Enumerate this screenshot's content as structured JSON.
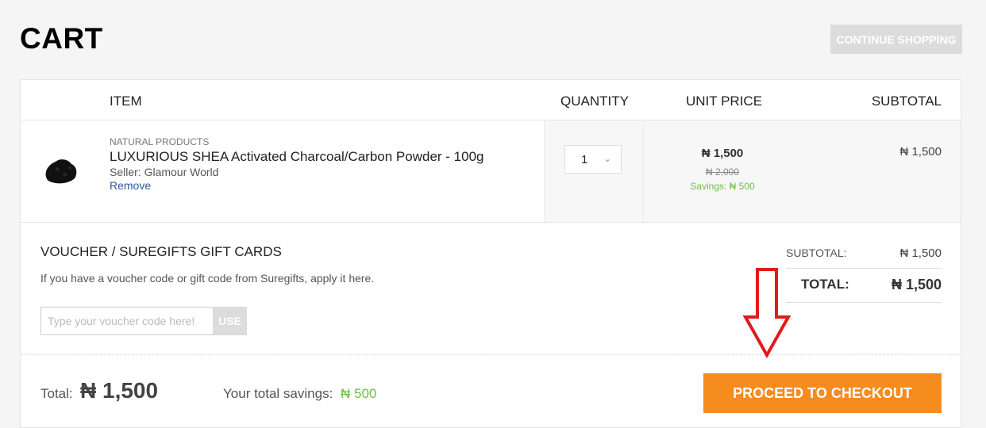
{
  "page": {
    "title": "CART",
    "continue_label": "CONTINUE SHOPPING"
  },
  "table": {
    "headers": {
      "item": "ITEM",
      "quantity": "QUANTITY",
      "unit_price": "UNIT PRICE",
      "subtotal": "SUBTOTAL"
    },
    "row": {
      "category": "NATURAL PRODUCTS",
      "name": "LUXURIOUS SHEA Activated Charcoal/Carbon Powder - 100g",
      "seller": "Seller: Glamour World",
      "remove_label": "Remove",
      "quantity": "1",
      "price": "₦ 1,500",
      "old_price": "₦ 2,000",
      "savings": "Savings: ₦ 500",
      "subtotal": "₦ 1,500"
    }
  },
  "voucher": {
    "title": "VOUCHER / SUREGIFTS GIFT CARDS",
    "description": "If you have a voucher code or gift code from Suregifts, apply it here.",
    "placeholder": "Type your voucher code here!",
    "use_label": "USE"
  },
  "summary": {
    "subtotal_label": "SUBTOTAL:",
    "subtotal_value": "₦ 1,500",
    "total_label": "TOTAL:",
    "total_value": "₦ 1,500"
  },
  "footer": {
    "total_label": "Total:",
    "total_value": "₦ 1,500",
    "savings_label": "Your total savings:",
    "savings_value": "₦ 500",
    "checkout_label": "PROCEED TO CHECKOUT"
  },
  "colors": {
    "accent": "#f68b1e",
    "savings": "#6cc04a",
    "link": "#2a5a9a",
    "annotation_arrow": "#e01b1b"
  }
}
